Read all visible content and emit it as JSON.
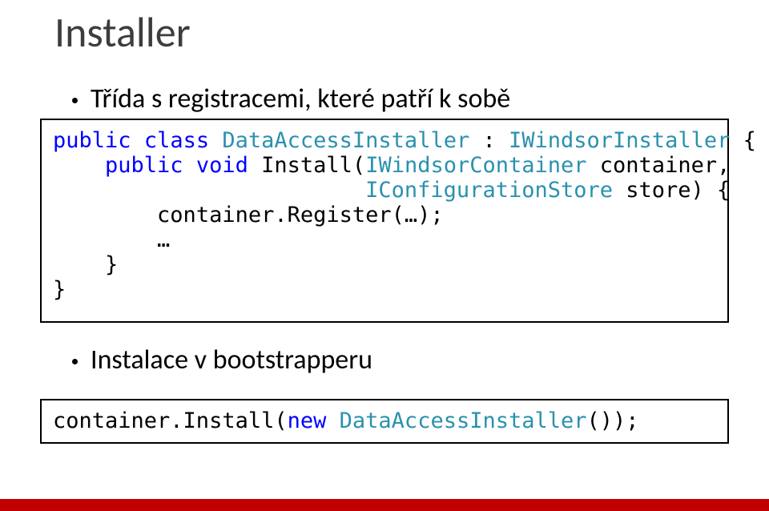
{
  "title": "Installer",
  "bullet1": "Třída s registracemi, které patří k sobě",
  "bullet2": "Instalace v bootstrapperu",
  "code1": {
    "kw_public1": "public",
    "kw_class": "class",
    "type_DataAccessInstaller": "DataAccessInstaller",
    "colon_space": " : ",
    "type_IWindsorInstaller": "IWindsorInstaller",
    "brace_open1": " {",
    "indent2": "    ",
    "kw_public2": "public",
    "kw_void": "void",
    "method_name": " Install(",
    "type_IWindsorContainer": "IWindsorContainer",
    "param1_tail": " container,",
    "indent_store": "                        ",
    "type_IConfigurationStore": "IConfigurationStore",
    "param2_tail": " store) {",
    "indent3": "        ",
    "register_call": "container.Register(…);",
    "ellipsis_line": "        …",
    "close_inner": "    }",
    "close_outer": "}"
  },
  "code2": {
    "prefix": "container.Install(",
    "kw_new": "new",
    "space": " ",
    "type_DataAccessInstaller": "DataAccessInstaller",
    "suffix": "());"
  }
}
